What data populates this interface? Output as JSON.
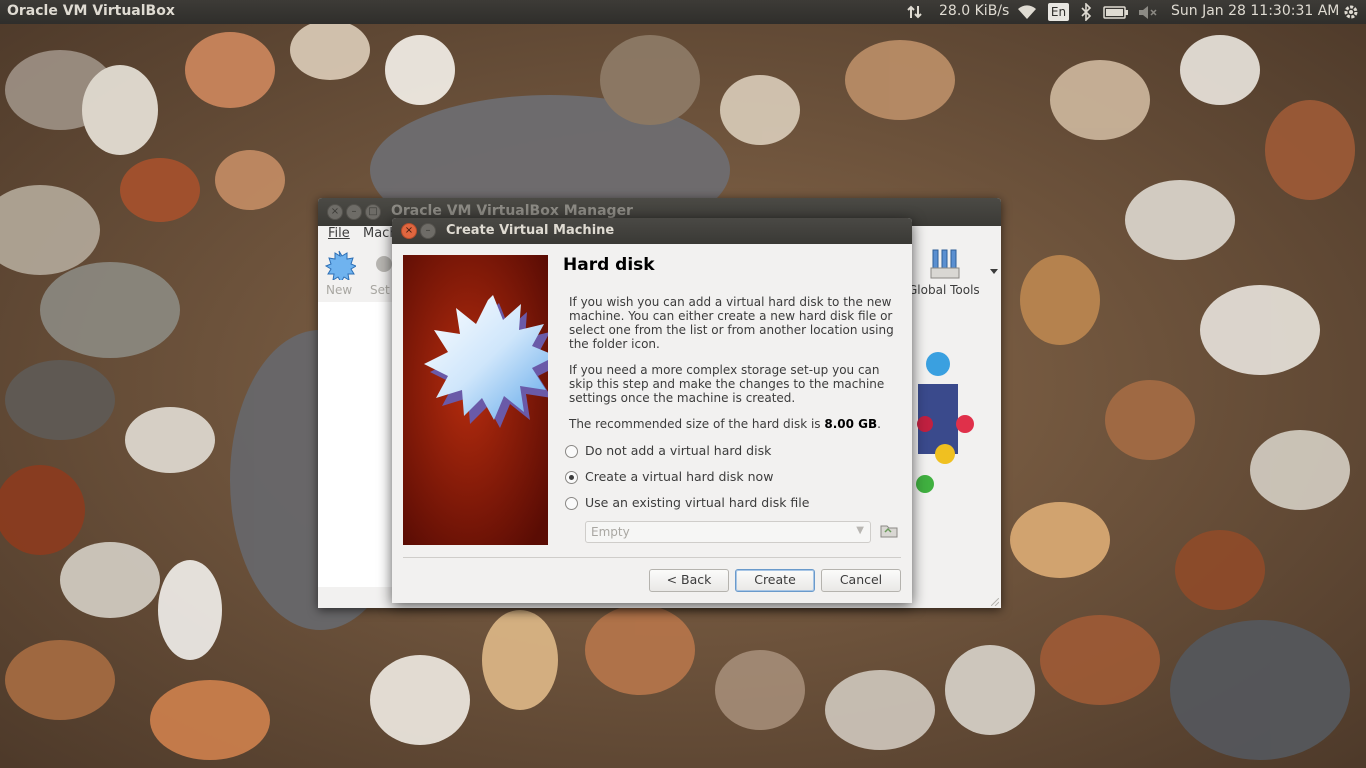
{
  "top_panel": {
    "app_title": "Oracle VM VirtualBox",
    "net_speed": "28.0 KiB/s",
    "keyboard_layout": "En",
    "datetime": "Sun Jan 28 11:30:31 AM",
    "icons": [
      "network-transfer-icon",
      "wifi-icon",
      "bluetooth-icon",
      "battery-icon",
      "volume-muted-icon",
      "power-gear-icon"
    ]
  },
  "manager": {
    "title": "Oracle VM VirtualBox Manager",
    "menu": {
      "file": "File",
      "machine": "Mach"
    },
    "toolbar": {
      "new": "New",
      "settings": "Set",
      "global_tools": "Global Tools"
    }
  },
  "dialog": {
    "title": "Create Virtual Machine",
    "heading": "Hard disk",
    "para1": "If you wish you can add a virtual hard disk to the new machine. You can either create a new hard disk file or select one from the list or from another location using the folder icon.",
    "para2": "If you need a more complex storage set-up you can skip this step and make the changes to the machine settings once the machine is created.",
    "rec_prefix": "The recommended size of the hard disk is ",
    "rec_size": "8.00 GB",
    "rec_suffix": ".",
    "options": [
      {
        "label": "Do not add a virtual hard disk",
        "selected": false
      },
      {
        "label": "Create a virtual hard disk now",
        "selected": true
      },
      {
        "label": "Use an existing virtual hard disk file",
        "selected": false
      }
    ],
    "disk_combo_value": "Empty",
    "buttons": {
      "back": "< Back",
      "create": "Create",
      "cancel": "Cancel"
    }
  }
}
